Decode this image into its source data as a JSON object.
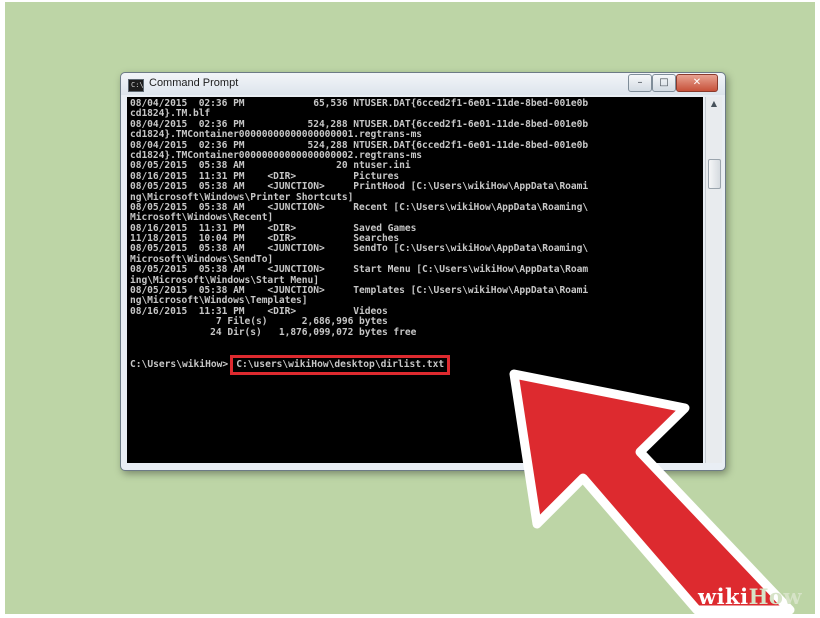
{
  "window": {
    "title": "Command Prompt",
    "icon": "cmd-window-icon",
    "title_icon_text": "C:\\",
    "buttons": {
      "minimize": "–",
      "maximize": "□",
      "close": "✕"
    }
  },
  "console": {
    "lines": [
      "08/04/2015  02:36 PM            65,536 NTUSER.DAT{6cced2f1-6e01-11de-8bed-001e0b",
      "cd1824}.TM.blf",
      "08/04/2015  02:36 PM           524,288 NTUSER.DAT{6cced2f1-6e01-11de-8bed-001e0b",
      "cd1824}.TMContainer00000000000000000001.regtrans-ms",
      "08/04/2015  02:36 PM           524,288 NTUSER.DAT{6cced2f1-6e01-11de-8bed-001e0b",
      "cd1824}.TMContainer00000000000000000002.regtrans-ms",
      "08/05/2015  05:38 AM                20 ntuser.ini",
      "08/16/2015  11:31 PM    <DIR>          Pictures",
      "08/05/2015  05:38 AM    <JUNCTION>     PrintHood [C:\\Users\\wikiHow\\AppData\\Roami",
      "ng\\Microsoft\\Windows\\Printer Shortcuts]",
      "08/05/2015  05:38 AM    <JUNCTION>     Recent [C:\\Users\\wikiHow\\AppData\\Roaming\\",
      "Microsoft\\Windows\\Recent]",
      "08/16/2015  11:31 PM    <DIR>          Saved Games",
      "11/18/2015  10:04 PM    <DIR>          Searches",
      "08/05/2015  05:38 AM    <JUNCTION>     SendTo [C:\\Users\\wikiHow\\AppData\\Roaming\\",
      "Microsoft\\Windows\\SendTo]",
      "08/05/2015  05:38 AM    <JUNCTION>     Start Menu [C:\\Users\\wikiHow\\AppData\\Roam",
      "ing\\Microsoft\\Windows\\Start Menu]",
      "08/05/2015  05:38 AM    <JUNCTION>     Templates [C:\\Users\\wikiHow\\AppData\\Roami",
      "ng\\Microsoft\\Windows\\Templates]",
      "08/16/2015  11:31 PM    <DIR>          Videos",
      "               7 File(s)      2,686,996 bytes",
      "              24 Dir(s)   1,876,099,072 bytes free"
    ],
    "prompt": "C:\\Users\\wikiHow>",
    "command": "C:\\users\\wikiHow\\desktop\\dirlist.txt",
    "highlight_color": "#dd2a2f"
  },
  "scrollbar": {
    "up_arrow": "▲"
  },
  "overlay": {
    "pointer": "red-arrow-pointer",
    "color": "#dd2a2f"
  },
  "watermark": {
    "wiki": "wiki",
    "how": "How"
  }
}
